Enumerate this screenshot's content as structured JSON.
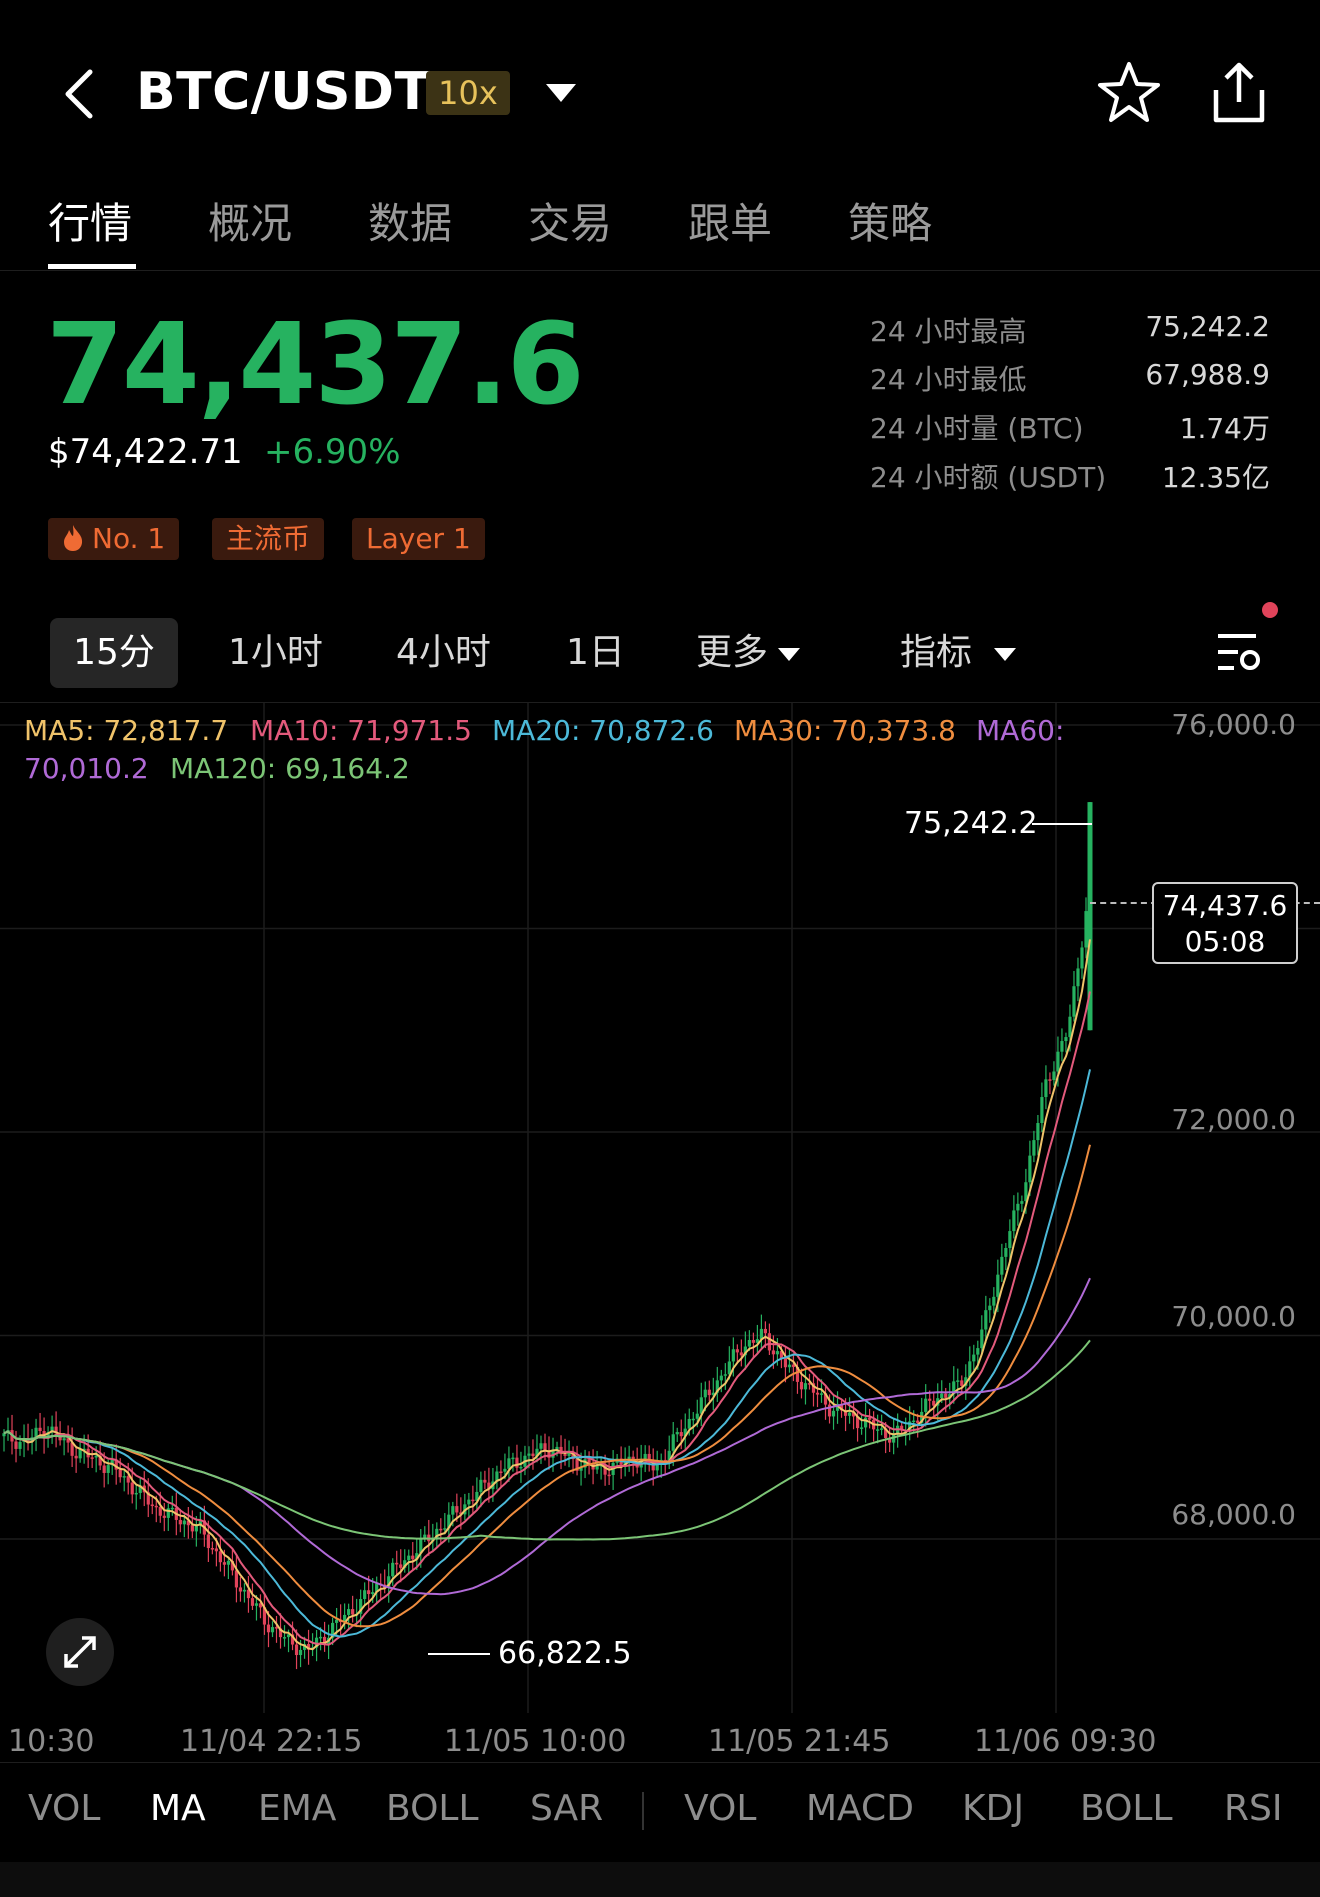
{
  "header": {
    "title": "BTC/USDT",
    "leverage": "10x"
  },
  "tabs": [
    "行情",
    "概况",
    "数据",
    "交易",
    "跟单",
    "策略"
  ],
  "price": {
    "last": "74,437.6",
    "usd": "$74,422.71",
    "change": "+6.90%"
  },
  "badges": [
    "No. 1",
    "主流币",
    "Layer 1"
  ],
  "stats": [
    {
      "label": "24 小时最高",
      "value": "75,242.2"
    },
    {
      "label": "24 小时最低",
      "value": "67,988.9"
    },
    {
      "label": "24 小时量 (BTC)",
      "value": "1.74万"
    },
    {
      "label": "24 小时额 (USDT)",
      "value": "12.35亿"
    }
  ],
  "periods": [
    "15分",
    "1小时",
    "4小时",
    "1日",
    "更多",
    "指标"
  ],
  "ma": {
    "ma5": "MA5: 72,817.7",
    "ma10": "MA10: 71,971.5",
    "ma20": "MA20: 70,872.6",
    "ma30": "MA30: 70,373.8",
    "ma60_a": "MA60:",
    "ma60_b": "70,010.2",
    "ma120": "MA120: 69,164.2"
  },
  "colors": {
    "up": "#26b260",
    "down": "#e0435a",
    "ma5": "#f0c36a",
    "ma10": "#e35a7c",
    "ma20": "#4cb9d8",
    "ma30": "#ef8d3f",
    "ma60": "#b06ad6",
    "ma120": "#7cc576"
  },
  "chart_data": {
    "type": "candlestick",
    "y_ticks": [
      "76,000.0",
      "72,000.0",
      "70,000.0",
      "68,000.0"
    ],
    "x_ticks": [
      "10:30",
      "11/04 22:15",
      "11/05 10:00",
      "11/05 21:45",
      "11/06 09:30"
    ],
    "ylim": [
      66300,
      76000
    ],
    "high_label": "75,242.2",
    "low_label": "66,822.5",
    "current_price": "74,437.6",
    "current_time": "05:08",
    "series_closes": [
      69000,
      68950,
      69100,
      68900,
      68800,
      68700,
      68500,
      68300,
      68200,
      68100,
      67800,
      67500,
      67200,
      67000,
      66900,
      67100,
      67300,
      67500,
      67700,
      67900,
      68100,
      68300,
      68500,
      68700,
      68800,
      68900,
      68800,
      68700,
      68700,
      68800,
      68700,
      69000,
      69300,
      69600,
      69900,
      70000,
      69700,
      69500,
      69300,
      69200,
      69100,
      69000,
      69200,
      69400,
      69500,
      70000,
      70800,
      71500,
      72500,
      73000,
      74437
    ]
  },
  "bottom_tabs": [
    "VOL",
    "MA",
    "EMA",
    "BOLL",
    "SAR",
    "VOL",
    "MACD",
    "KDJ",
    "BOLL",
    "RSI"
  ]
}
